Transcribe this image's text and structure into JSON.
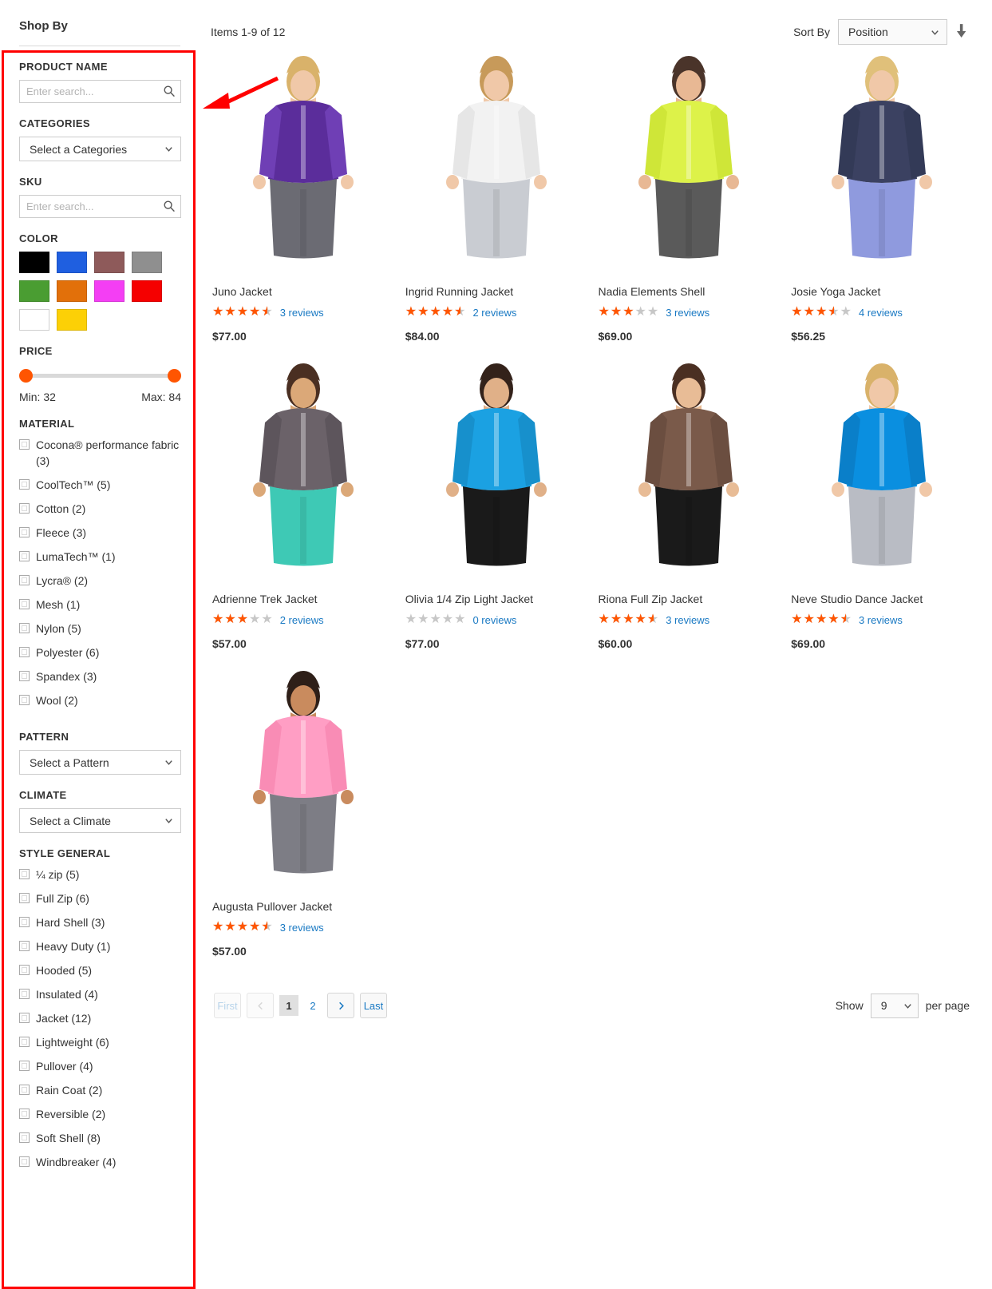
{
  "sidebar": {
    "heading": "Shop By",
    "product_name": {
      "title": "PRODUCT NAME",
      "placeholder": "Enter search...",
      "value": "",
      "icon": "search-icon"
    },
    "categories": {
      "title": "CATEGORIES",
      "selected": "Select a Categories",
      "icon": "chevron-down-icon"
    },
    "sku": {
      "title": "SKU",
      "placeholder": "Enter search...",
      "value": "",
      "icon": "search-icon"
    },
    "color": {
      "title": "COLOR",
      "swatches": [
        {
          "name": "black",
          "hex": "#000000"
        },
        {
          "name": "blue",
          "hex": "#1f5fe0"
        },
        {
          "name": "brown",
          "hex": "#8e5a5a"
        },
        {
          "name": "gray",
          "hex": "#8f8f8f"
        },
        {
          "name": "green",
          "hex": "#4a9d32"
        },
        {
          "name": "orange",
          "hex": "#e2700a"
        },
        {
          "name": "magenta",
          "hex": "#f43ef4"
        },
        {
          "name": "red",
          "hex": "#f50000"
        },
        {
          "name": "white",
          "hex": "#ffffff"
        },
        {
          "name": "yellow",
          "hex": "#fcd006"
        }
      ]
    },
    "price": {
      "title": "PRICE",
      "min_label": "Min: 32",
      "max_label": "Max: 84",
      "knob_color": "#ff5501"
    },
    "material": {
      "title": "MATERIAL",
      "options": [
        "Cocona® performance fabric (3)",
        "CoolTech™ (5)",
        "Cotton (2)",
        "Fleece (3)",
        "LumaTech™ (1)",
        "Lycra® (2)",
        "Mesh (1)",
        "Nylon (5)",
        "Polyester (6)",
        "Spandex (3)",
        "Wool (2)"
      ]
    },
    "pattern": {
      "title": "PATTERN",
      "selected": "Select a Pattern",
      "icon": "chevron-down-icon"
    },
    "climate": {
      "title": "CLIMATE",
      "selected": "Select a Climate",
      "icon": "chevron-down-icon"
    },
    "style_general": {
      "title": "STYLE GENERAL",
      "options": [
        "¼ zip (5)",
        "Full Zip (6)",
        "Hard Shell (3)",
        "Heavy Duty (1)",
        "Hooded (5)",
        "Insulated (4)",
        "Jacket (12)",
        "Lightweight (6)",
        "Pullover (4)",
        "Rain Coat (2)",
        "Reversible (2)",
        "Soft Shell (8)",
        "Windbreaker (4)"
      ]
    },
    "highlight_color": "#ff0000"
  },
  "toolbar": {
    "items_count": "Items 1-9 of 12",
    "sort_by_label": "Sort By",
    "sort_value": "Position",
    "sort_direction_icon": "arrow-down-icon"
  },
  "products": [
    {
      "name": "Juno Jacket",
      "rating": 4.5,
      "reviews": "3 reviews",
      "price": "$77.00",
      "img": {
        "top": "#5b2d9b",
        "bottom": "#6f3fb5",
        "pants": "#6b6b73",
        "hair": "#d9b26a",
        "skin": "#f0c8a8"
      }
    },
    {
      "name": "Ingrid Running Jacket",
      "rating": 4.5,
      "reviews": "2 reviews",
      "price": "$84.00",
      "img": {
        "top": "#f2f2f2",
        "bottom": "#e6e6e6",
        "pants": "#c9ccd2",
        "hair": "#c79a5a",
        "skin": "#f0c8a8"
      }
    },
    {
      "name": "Nadia Elements Shell",
      "rating": 3.0,
      "reviews": "3 reviews",
      "price": "$69.00",
      "img": {
        "top": "#ddf249",
        "bottom": "#cfe638",
        "pants": "#5a5a5a",
        "hair": "#4a342a",
        "skin": "#e8b894"
      }
    },
    {
      "name": "Josie Yoga Jacket",
      "rating": 3.5,
      "reviews": "4 reviews",
      "price": "$56.25",
      "img": {
        "top": "#3b4161",
        "bottom": "#333a57",
        "pants": "#8f9ade",
        "hair": "#e0c07a",
        "skin": "#f0c8a8"
      }
    },
    {
      "name": "Adrienne Trek Jacket",
      "rating": 3.0,
      "reviews": "2 reviews",
      "price": "$57.00",
      "img": {
        "top": "#6b6269",
        "bottom": "#5d555c",
        "pants": "#3ec9b5",
        "hair": "#4a2f22",
        "skin": "#dba878"
      }
    },
    {
      "name": "Olivia 1/4 Zip Light Jacket",
      "rating": 0,
      "reviews": "0 reviews",
      "price": "$77.00",
      "img": {
        "top": "#1ba1e2",
        "bottom": "#1790cc",
        "pants": "#1a1a1a",
        "hair": "#33221a",
        "skin": "#e0b088"
      }
    },
    {
      "name": "Riona Full Zip Jacket",
      "rating": 4.5,
      "reviews": "3 reviews",
      "price": "$60.00",
      "img": {
        "top": "#7a5a4a",
        "bottom": "#6b4e40",
        "pants": "#1a1a1a",
        "hair": "#4a2f22",
        "skin": "#e8bc96"
      }
    },
    {
      "name": "Neve Studio Dance Jacket",
      "rating": 4.5,
      "reviews": "3 reviews",
      "price": "$69.00",
      "img": {
        "top": "#0a8fe0",
        "bottom": "#0a7fc9",
        "pants": "#b9bcc4",
        "hair": "#d9b26a",
        "skin": "#f0c8a8"
      }
    },
    {
      "name": "Augusta Pullover Jacket",
      "rating": 4.5,
      "reviews": "3 reviews",
      "price": "$57.00",
      "img": {
        "top": "#ff9ec4",
        "bottom": "#f98cb5",
        "pants": "#7d7d85",
        "hair": "#2e1f18",
        "skin": "#c98b5e"
      }
    }
  ],
  "pagination": {
    "first_label": "First",
    "prev_icon": "chevron-left-icon",
    "pages": [
      "1",
      "2"
    ],
    "current_page": "1",
    "next_icon": "chevron-right-icon",
    "last_label": "Last"
  },
  "per_page": {
    "show_label": "Show",
    "value": "9",
    "suffix_label": "per page",
    "icon": "chevron-down-icon"
  }
}
